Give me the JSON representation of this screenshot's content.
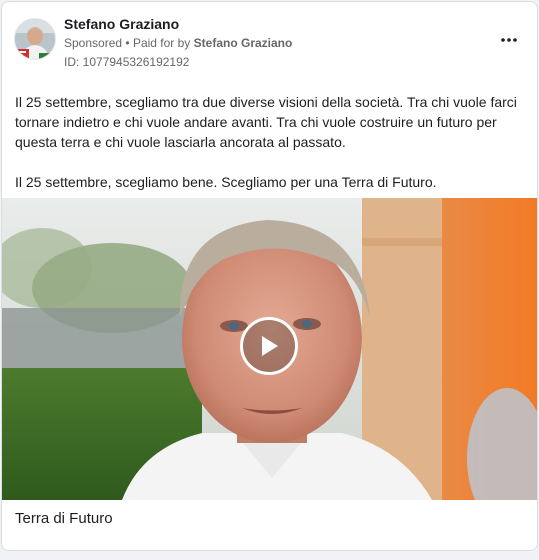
{
  "advertiser": {
    "name": "Stefano Graziano",
    "sponsored_label": "Sponsored",
    "separator": "•",
    "paid_for_prefix": "Paid for by",
    "paid_for_name": "Stefano Graziano",
    "id_text": "ID: 1077945326192192"
  },
  "menu_icon": "more-horizontal-icon",
  "body": {
    "paragraph_1": "Il 25 settembre, scegliamo tra due diverse visioni della società. Tra chi vuole farci tornare indietro e chi vuole andare avanti. Tra chi vuole costruire un futuro per questa terra e chi vuole lasciarla ancorata al passato.",
    "paragraph_2": "Il 25 settembre, scegliamo bene. Scegliamo per una Terra di Futuro."
  },
  "media": {
    "type": "video",
    "play_icon": "play-icon"
  },
  "caption": "Terra di Futuro",
  "colors": {
    "card_bg": "#ffffff",
    "page_bg": "#f0f2f5",
    "secondary_text": "#65676b",
    "primary_text": "#1c1e21",
    "orange_wall": "#f08a3a"
  }
}
